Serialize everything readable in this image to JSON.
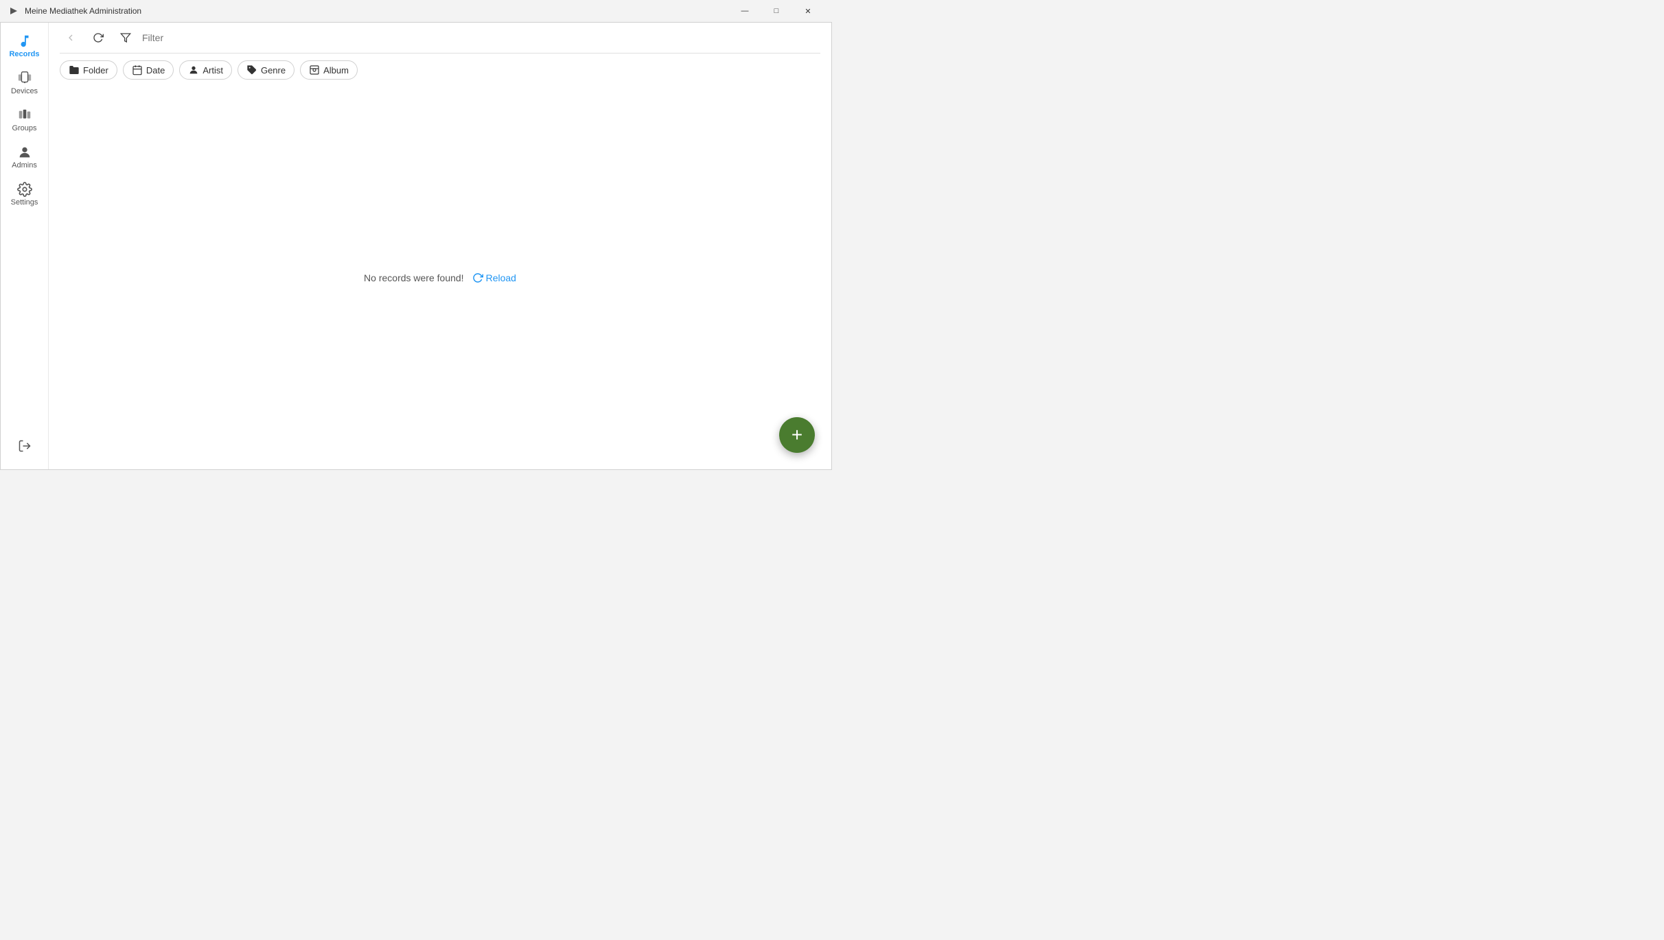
{
  "titlebar": {
    "title": "Meine Mediathek Administration",
    "icon": "▶",
    "minimize": "—",
    "maximize": "□",
    "close": "✕"
  },
  "sidebar": {
    "items": [
      {
        "id": "records",
        "label": "Records",
        "icon": "music",
        "active": true
      },
      {
        "id": "devices",
        "label": "Devices",
        "icon": "device"
      },
      {
        "id": "groups",
        "label": "Groups",
        "icon": "groups"
      },
      {
        "id": "admins",
        "label": "Admins",
        "icon": "person"
      },
      {
        "id": "settings",
        "label": "Settings",
        "icon": "gear"
      }
    ],
    "logout_label": "logout"
  },
  "toolbar": {
    "back_label": "back",
    "refresh_label": "refresh",
    "filter_label": "filter",
    "filter_placeholder": "Filter"
  },
  "filter_chips": [
    {
      "id": "folder",
      "label": "Folder",
      "icon": "folder"
    },
    {
      "id": "date",
      "label": "Date",
      "icon": "calendar"
    },
    {
      "id": "artist",
      "label": "Artist",
      "icon": "person"
    },
    {
      "id": "genre",
      "label": "Genre",
      "icon": "tag"
    },
    {
      "id": "album",
      "label": "Album",
      "icon": "album"
    }
  ],
  "content": {
    "empty_message": "No records were found!",
    "reload_label": "Reload"
  },
  "fab": {
    "label": "+",
    "color": "#4a7c2f"
  }
}
